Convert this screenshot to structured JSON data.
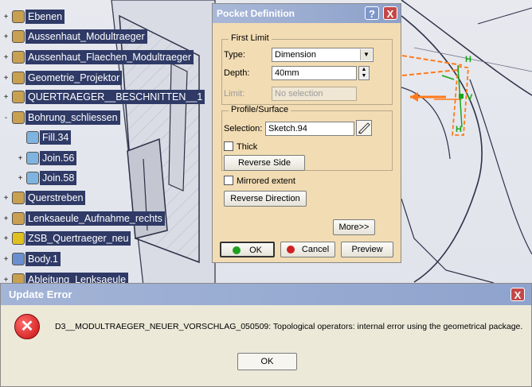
{
  "tree": {
    "items": [
      {
        "label": "Ebenen",
        "icon": "geometrical-set-icon",
        "expander": "+"
      },
      {
        "label": "Aussenhaut_Modultraeger",
        "icon": "geometrical-set-icon",
        "expander": "+"
      },
      {
        "label": "Aussenhaut_Flaechen_Modultraeger",
        "icon": "geometrical-set-icon",
        "expander": "+"
      },
      {
        "label": "Geometrie_Projektor",
        "icon": "geometrical-set-icon",
        "expander": "+"
      },
      {
        "label": "QUERTRAEGER__BESCHNITTEN__1",
        "icon": "geometrical-set-icon",
        "expander": "+"
      },
      {
        "label": "Bohrung_schliessen",
        "icon": "geometrical-set-icon",
        "expander": "-"
      },
      {
        "label": "Fill.34",
        "icon": "fill-surface-icon",
        "expander": ""
      },
      {
        "label": "Join.56",
        "icon": "join-surface-icon",
        "expander": "+"
      },
      {
        "label": "Join.58",
        "icon": "join-surface-icon",
        "expander": "+"
      },
      {
        "label": "Querstreben",
        "icon": "geometrical-set-icon",
        "expander": "+"
      },
      {
        "label": "Lenksaeule_Aufnahme_rechts",
        "icon": "geometrical-set-icon",
        "expander": "+"
      },
      {
        "label": "ZSB_Quertraeger_neu",
        "icon": "error-part-icon",
        "expander": "+"
      },
      {
        "label": "Body.1",
        "icon": "body-icon",
        "expander": "+"
      },
      {
        "label": "Ableitung_Lenksaeule",
        "icon": "geometrical-set-icon",
        "expander": "+"
      }
    ]
  },
  "pocket": {
    "title": "Pocket Definition",
    "help_label": "?",
    "close_label": "X",
    "first_limit": {
      "group_label": "First Limit",
      "type_label": "Type:",
      "type_value": "Dimension",
      "depth_label": "Depth:",
      "depth_value": "40mm",
      "limit_label": "Limit:",
      "limit_value": "No selection"
    },
    "profile": {
      "group_label": "Profile/Surface",
      "selection_label": "Selection:",
      "selection_value": "Sketch.94",
      "thick_label": "Thick",
      "reverse_side_label": "Reverse Side"
    },
    "mirrored_label": "Mirrored extent",
    "reverse_direction_label": "Reverse Direction",
    "more_label": "More>>",
    "ok_label": "OK",
    "cancel_label": "Cancel",
    "preview_label": "Preview"
  },
  "error_dialog": {
    "title": "Update Error",
    "close_label": "X",
    "message": "D3__MODULTRAEGER_NEUER_VORSCHLAG_050509: Topological operators: internal error using the geometrical package.",
    "ok_label": "OK"
  },
  "viewport": {
    "handle_label_h1": "H",
    "handle_label_v": "V",
    "handle_label_h2": "H"
  },
  "colors": {
    "tree_label_bg": "#2f3a66",
    "dialog_bg": "#f2dcb3",
    "titlebar": "#8ca0c9",
    "error_bg": "#ece9d8",
    "orange_preview": "#ff7a1a",
    "green_handle": "#1aa51a"
  }
}
